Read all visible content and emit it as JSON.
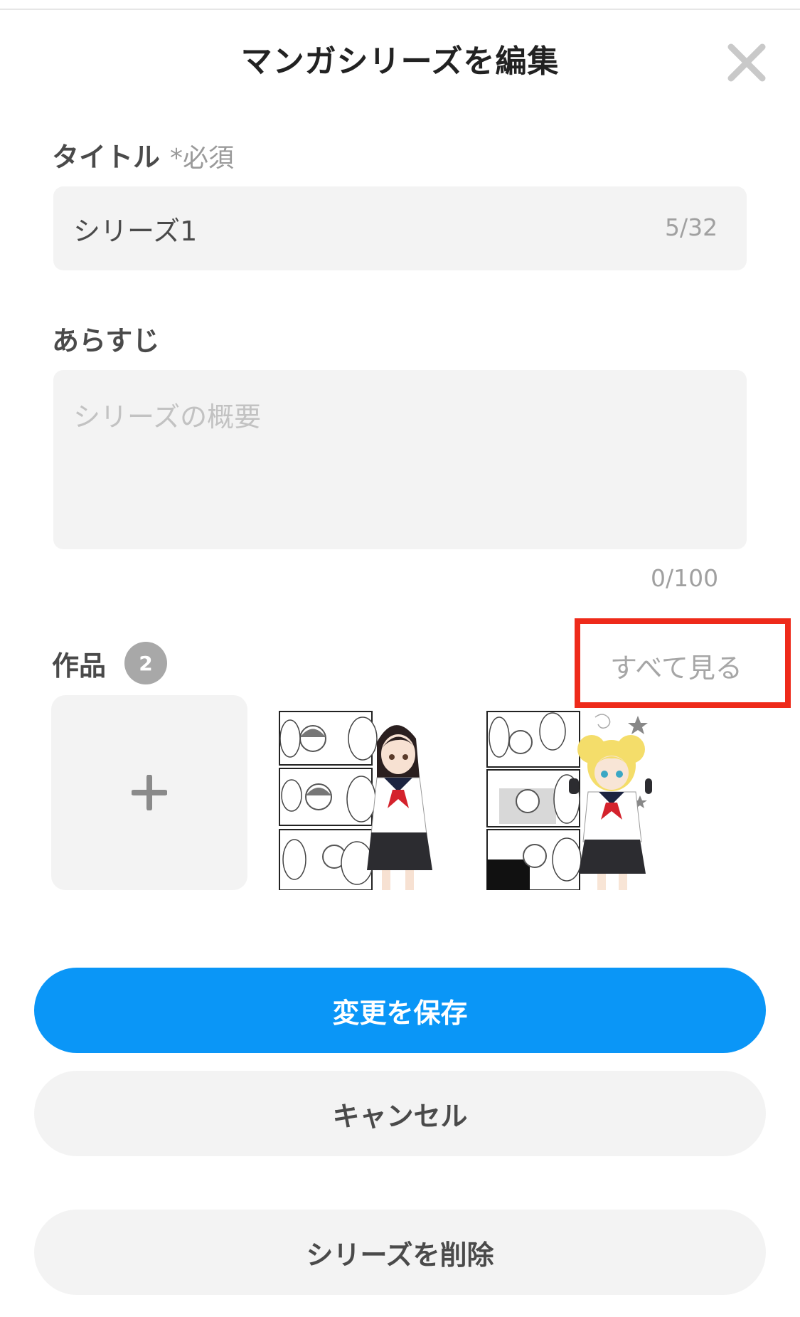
{
  "header": {
    "title": "マンガシリーズを編集",
    "close_icon": "close-icon"
  },
  "title_field": {
    "label": "タイトル",
    "required": "*必須",
    "value": "シリーズ1",
    "counter": "5/32"
  },
  "synopsis_field": {
    "label": "あらすじ",
    "placeholder": "シリーズの概要",
    "counter": "0/100"
  },
  "works": {
    "label": "作品",
    "count": "2",
    "see_all": "すべて見る",
    "add_icon": "plus-icon",
    "items": [
      {
        "name": "manga-thumbnail-1"
      },
      {
        "name": "manga-thumbnail-2"
      }
    ]
  },
  "buttons": {
    "save": "変更を保存",
    "cancel": "キャンセル",
    "delete": "シリーズを削除"
  },
  "colors": {
    "primary": "#0a96f7",
    "highlight": "#ee2a1a",
    "field_bg": "#f3f3f3"
  }
}
